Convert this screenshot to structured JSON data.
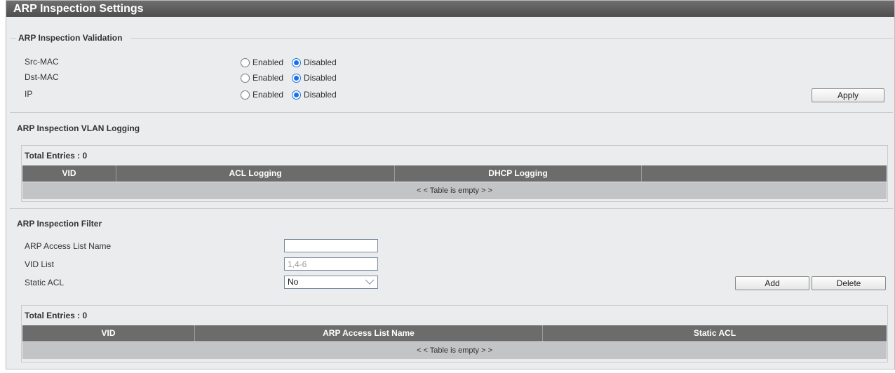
{
  "title": "ARP Inspection Settings",
  "validation": {
    "heading": "ARP Inspection Validation",
    "rows": [
      {
        "label": "Src-MAC",
        "enabled": "Enabled",
        "disabled": "Disabled",
        "selected": "Disabled"
      },
      {
        "label": "Dst-MAC",
        "enabled": "Enabled",
        "disabled": "Disabled",
        "selected": "Disabled"
      },
      {
        "label": "IP",
        "enabled": "Enabled",
        "disabled": "Disabled",
        "selected": "Disabled"
      }
    ],
    "apply_label": "Apply"
  },
  "vlan_logging": {
    "heading": "ARP Inspection VLAN Logging",
    "total_entries": "Total Entries : 0",
    "columns": [
      "VID",
      "ACL Logging",
      "DHCP Logging",
      ""
    ],
    "empty_text": "< < Table is empty > >"
  },
  "filter": {
    "heading": "ARP Inspection Filter",
    "acl_name_label": "ARP Access List Name",
    "acl_name_value": "",
    "vid_list_label": "VID List",
    "vid_list_placeholder": "1,4-6",
    "static_acl_label": "Static ACL",
    "static_acl_value": "No",
    "add_label": "Add",
    "delete_label": "Delete",
    "total_entries": "Total Entries : 0",
    "columns": [
      "VID",
      "ARP Access List Name",
      "Static ACL"
    ],
    "empty_text": "< < Table is empty > >"
  },
  "colors": {
    "header_bg": "#6c6c6c",
    "page_bg": "#eaeced",
    "radio_accent": "#1a73e8"
  }
}
